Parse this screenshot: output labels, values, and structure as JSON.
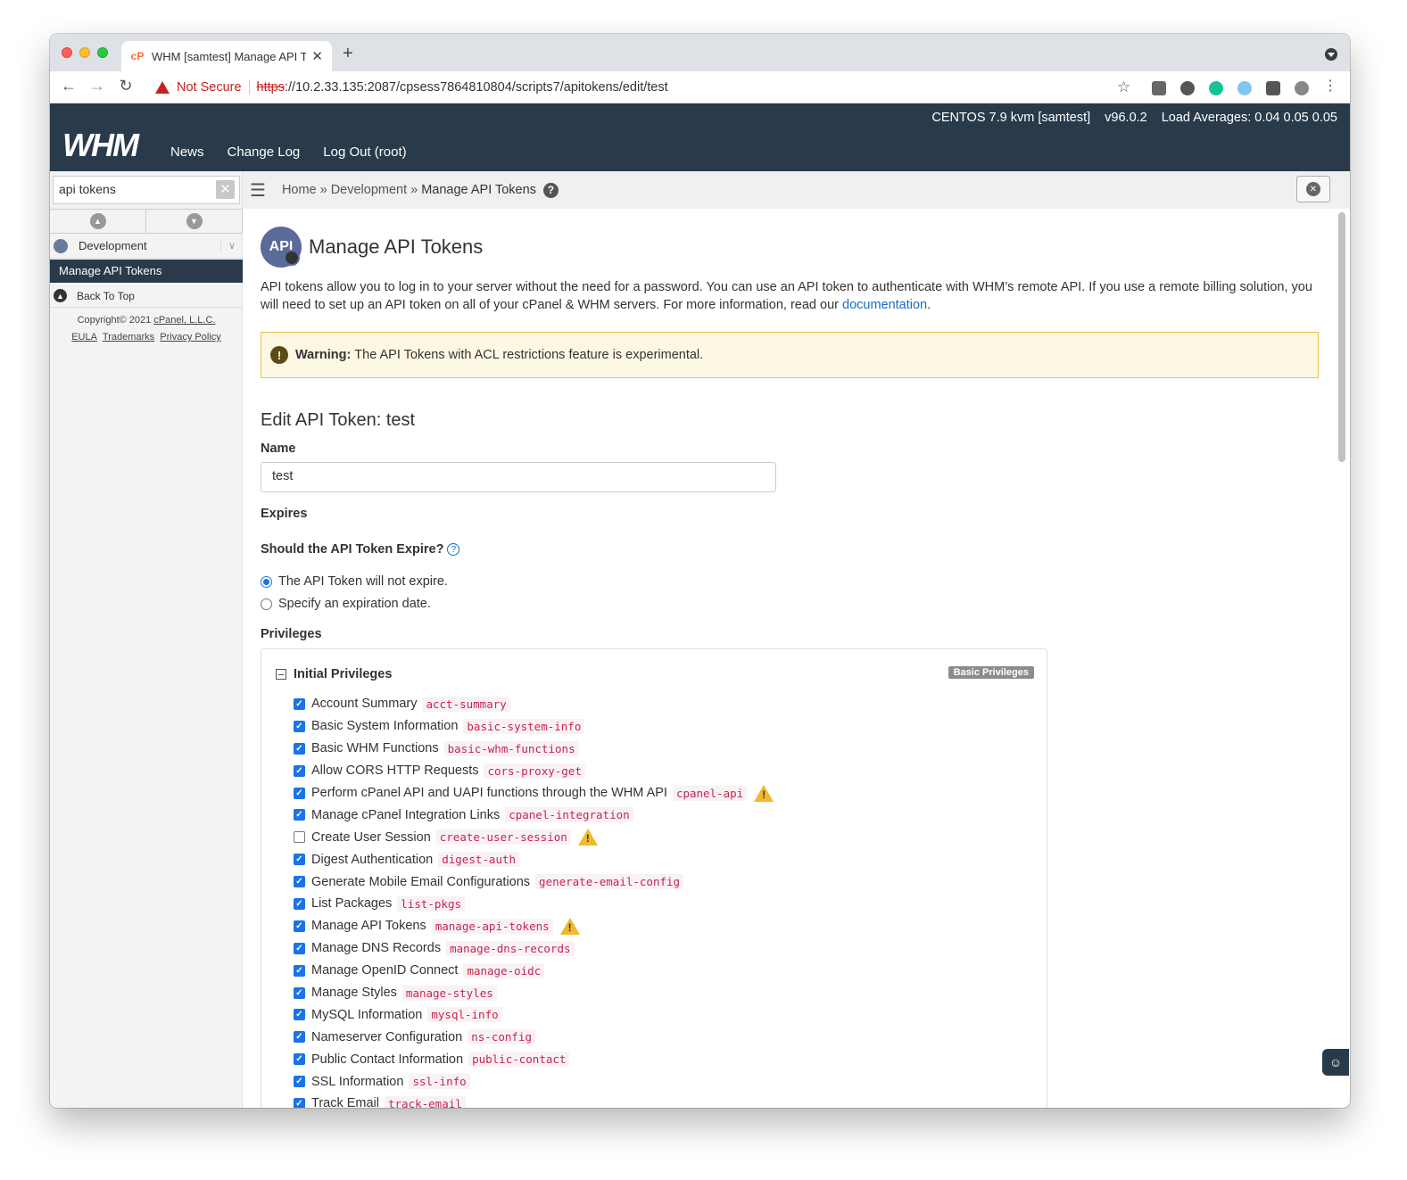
{
  "browser": {
    "tab_title": "WHM [samtest] Manage API To",
    "tab_favicon": "cP",
    "new_tab": "+",
    "not_secure": "Not Secure",
    "url_scheme": "https",
    "url_rest": "://10.2.33.135:2087/cpsess7864810804/scripts7/apitokens/edit/test"
  },
  "whm": {
    "logo": "WHM",
    "nav": [
      "News",
      "Change Log",
      "Log Out (root)"
    ],
    "server": "CENTOS 7.9 kvm [samtest]",
    "version": "v96.0.2",
    "load": "Load Averages: 0.04 0.05 0.05"
  },
  "sidebar": {
    "search_value": "api tokens",
    "category": "Development",
    "active_item": "Manage API Tokens",
    "back_to_top": "Back To Top",
    "copyright": "Copyright© 2021",
    "company": "cPanel, L.L.C.",
    "links": [
      "EULA",
      "Trademarks",
      "Privacy Policy"
    ]
  },
  "breadcrumb": {
    "items": [
      "Home",
      "Development",
      "Manage API Tokens"
    ],
    "sep": "»"
  },
  "page": {
    "icon_text": "API",
    "title": "Manage API Tokens",
    "intro": "API tokens allow you to log in to your server without the need for a password. You can use an API token to authenticate with WHM’s remote API. If you use a remote billing solution, you will need to set up an API token on all of your cPanel & WHM servers. For more information, read our",
    "intro_link": "documentation",
    "intro_end": ".",
    "warning_label": "Warning:",
    "warning_text": "The API Tokens with ACL restrictions feature is experimental.",
    "edit_heading": "Edit API Token: test",
    "name_label": "Name",
    "name_value": "test",
    "expires_label": "Expires",
    "expire_question": "Should the API Token Expire?",
    "radio_no_expire": "The API Token will not expire.",
    "radio_specify": "Specify an expiration date.",
    "privileges_label": "Privileges",
    "initial_privileges": "Initial Privileges",
    "basic_badge": "Basic Privileges"
  },
  "privileges": [
    {
      "label": "Account Summary",
      "code": "acct-summary",
      "checked": true,
      "warn": false
    },
    {
      "label": "Basic System Information",
      "code": "basic-system-info",
      "checked": true,
      "warn": false
    },
    {
      "label": "Basic WHM Functions",
      "code": "basic-whm-functions",
      "checked": true,
      "warn": false
    },
    {
      "label": "Allow CORS HTTP Requests",
      "code": "cors-proxy-get",
      "checked": true,
      "warn": false
    },
    {
      "label": "Perform cPanel API and UAPI functions through the WHM API",
      "code": "cpanel-api",
      "checked": true,
      "warn": true
    },
    {
      "label": "Manage cPanel Integration Links",
      "code": "cpanel-integration",
      "checked": true,
      "warn": false
    },
    {
      "label": "Create User Session",
      "code": "create-user-session",
      "checked": false,
      "warn": true
    },
    {
      "label": "Digest Authentication",
      "code": "digest-auth",
      "checked": true,
      "warn": false
    },
    {
      "label": "Generate Mobile Email Configurations",
      "code": "generate-email-config",
      "checked": true,
      "warn": false
    },
    {
      "label": "List Packages",
      "code": "list-pkgs",
      "checked": true,
      "warn": false
    },
    {
      "label": "Manage API Tokens",
      "code": "manage-api-tokens",
      "checked": true,
      "warn": true
    },
    {
      "label": "Manage DNS Records",
      "code": "manage-dns-records",
      "checked": true,
      "warn": false
    },
    {
      "label": "Manage OpenID Connect",
      "code": "manage-oidc",
      "checked": true,
      "warn": false
    },
    {
      "label": "Manage Styles",
      "code": "manage-styles",
      "checked": true,
      "warn": false
    },
    {
      "label": "MySQL Information",
      "code": "mysql-info",
      "checked": true,
      "warn": false
    },
    {
      "label": "Nameserver Configuration",
      "code": "ns-config",
      "checked": true,
      "warn": false
    },
    {
      "label": "Public Contact Information",
      "code": "public-contact",
      "checked": true,
      "warn": false
    },
    {
      "label": "SSL Information",
      "code": "ssl-info",
      "checked": true,
      "warn": false
    },
    {
      "label": "Track Email",
      "code": "track-email",
      "checked": true,
      "warn": false
    }
  ],
  "colors": {
    "header_bg": "#293a4a",
    "accent_blue": "#1a73e8",
    "warning_bg": "#fcf8e3",
    "code_red": "#c7254e"
  }
}
